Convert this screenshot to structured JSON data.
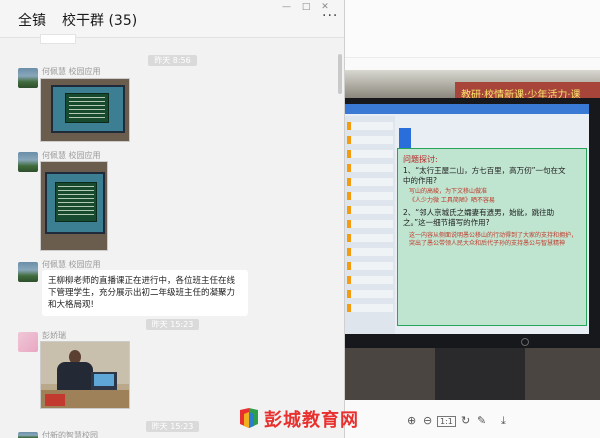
{
  "header": {
    "tab_all": "全镇",
    "group_title": "校干群 (35)",
    "more": "···",
    "controls": [
      "—",
      "□",
      "✕"
    ]
  },
  "messages": {
    "timestamps": [
      "昨天 8:56",
      "昨天 15:23",
      "昨天 15:23"
    ],
    "sender_1": "何佩慧  校园应用",
    "sender_2": "何佩慧  校园应用",
    "sender_3": "何佩慧  校园应用",
    "text_message": "王柳柳老师的直播课正在进行中，各位班主任在线下管理学生，充分展示出初二年级班主任的凝聚力和大格局观!",
    "sender_4": "彭娇瑞",
    "bottom_preview": "付新的智慧校园"
  },
  "slide": {
    "title": "问题探讨:",
    "q1": "1、“太行王屋二山，方七百里，高万仞”一句在文中的作用?",
    "q1_note_1": "写山的高峻，为下文移山做准",
    "q1_note_2": "《人少力微 工具简陋》晒不容易",
    "q2": "2、“邻人京城氏之孀妻有遗男，始龀，跳往助之。”这一细节描写的作用?",
    "q2_note": "这一内容从侧面说明愚公移山的行动得到了大家的支持和拥护，突出了愚公带领人民大众和后代子孙的支持愚公与智慧精神"
  },
  "banner": "教研·校情新课·少年活力·课",
  "toolbar": {
    "zoom_in": "⊕",
    "zoom_out": "⊖",
    "actual": "1:1",
    "rotate": "↻",
    "edit": "✎",
    "download": "⤓"
  },
  "watermark": {
    "text": "彭城教育网"
  },
  "colors": {
    "accent_red": "#e8312f",
    "chat_bg": "#f2f2f2"
  }
}
